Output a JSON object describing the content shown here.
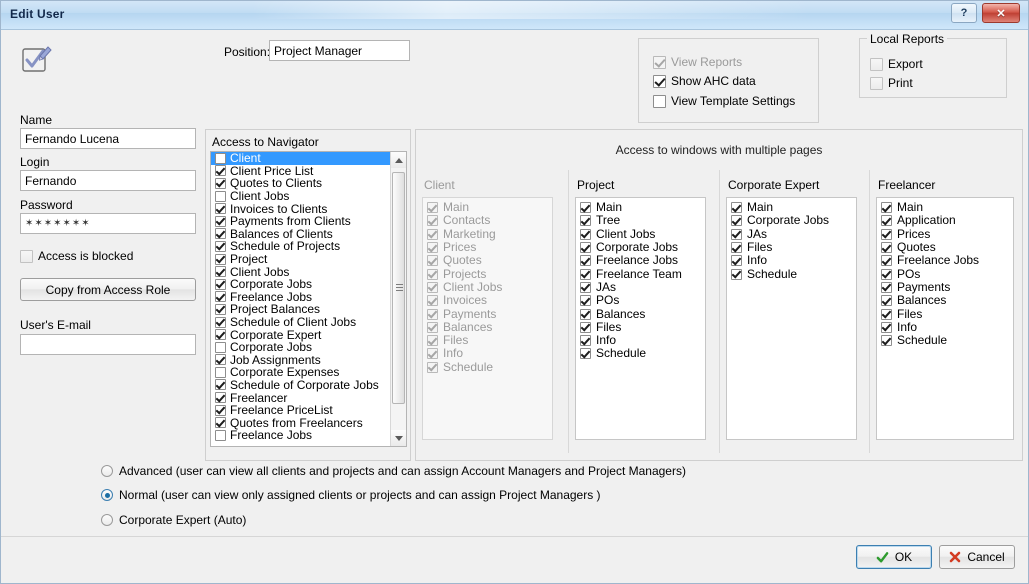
{
  "window": {
    "title": "Edit User",
    "help_button": "?",
    "close_button": "✕",
    "icon": "edit-checkbox-pencil-icon"
  },
  "header": {
    "position_label": "Position:",
    "position_value": "Project Manager",
    "position_placeholder": ""
  },
  "left_form": {
    "name_label": "Name",
    "name_value": "Fernando Lucena",
    "login_label": "Login",
    "login_value": "Fernando",
    "password_label": "Password",
    "password_value": "✶✶✶✶✶✶✶",
    "access_blocked_label": "Access is blocked",
    "access_blocked_checked": false,
    "copy_role_button": "Copy from Access Role",
    "email_label": "User's E-mail",
    "email_value": "",
    "email_placeholder": ""
  },
  "reports_group": {
    "items": [
      {
        "label": "View Reports",
        "checked": true,
        "disabled": true
      },
      {
        "label": "Show AHC data",
        "checked": true,
        "disabled": false
      },
      {
        "label": "View Template Settings",
        "checked": false,
        "disabled": false
      }
    ]
  },
  "local_reports": {
    "legend": "Local Reports",
    "items": [
      {
        "label": "Export",
        "checked": false,
        "disabled": true
      },
      {
        "label": "Print",
        "checked": false,
        "disabled": true
      }
    ]
  },
  "navigator": {
    "title": "Access to Navigator",
    "items": [
      {
        "label": "Client",
        "checked": false,
        "selected": true
      },
      {
        "label": "Client Price List",
        "checked": true,
        "selected": false
      },
      {
        "label": "Quotes to Clients",
        "checked": true,
        "selected": false
      },
      {
        "label": "Client Jobs",
        "checked": false,
        "selected": false
      },
      {
        "label": "Invoices to Clients",
        "checked": true,
        "selected": false
      },
      {
        "label": "Payments from Clients",
        "checked": true,
        "selected": false
      },
      {
        "label": "Balances of Clients",
        "checked": true,
        "selected": false
      },
      {
        "label": "Schedule of Projects",
        "checked": true,
        "selected": false
      },
      {
        "label": "Project",
        "checked": true,
        "selected": false
      },
      {
        "label": "Client Jobs",
        "checked": true,
        "selected": false
      },
      {
        "label": "Corporate Jobs",
        "checked": true,
        "selected": false
      },
      {
        "label": "Freelance Jobs",
        "checked": true,
        "selected": false
      },
      {
        "label": "Project Balances",
        "checked": true,
        "selected": false
      },
      {
        "label": "Schedule of Client Jobs",
        "checked": true,
        "selected": false
      },
      {
        "label": "Corporate Expert",
        "checked": true,
        "selected": false
      },
      {
        "label": "Corporate Jobs",
        "checked": false,
        "selected": false
      },
      {
        "label": "Job Assignments",
        "checked": true,
        "selected": false
      },
      {
        "label": "Corporate Expenses",
        "checked": false,
        "selected": false
      },
      {
        "label": "Schedule of Corporate Jobs",
        "checked": true,
        "selected": false
      },
      {
        "label": "Freelancer",
        "checked": true,
        "selected": false
      },
      {
        "label": "Freelance PriceList",
        "checked": true,
        "selected": false
      },
      {
        "label": "Quotes from Freelancers",
        "checked": true,
        "selected": false
      },
      {
        "label": "Freelance Jobs",
        "checked": false,
        "selected": false
      }
    ]
  },
  "pages_panel": {
    "title": "Access to windows with multiple pages",
    "columns": [
      {
        "title": "Client",
        "disabled": true,
        "items": [
          {
            "label": "Main",
            "checked": true
          },
          {
            "label": "Contacts",
            "checked": true
          },
          {
            "label": "Marketing",
            "checked": true
          },
          {
            "label": "Prices",
            "checked": true
          },
          {
            "label": "Quotes",
            "checked": true
          },
          {
            "label": "Projects",
            "checked": true
          },
          {
            "label": "Client Jobs",
            "checked": true
          },
          {
            "label": "Invoices",
            "checked": true
          },
          {
            "label": "Payments",
            "checked": true
          },
          {
            "label": "Balances",
            "checked": true
          },
          {
            "label": "Files",
            "checked": true
          },
          {
            "label": "Info",
            "checked": true
          },
          {
            "label": "Schedule",
            "checked": true
          }
        ]
      },
      {
        "title": "Project",
        "disabled": false,
        "items": [
          {
            "label": "Main",
            "checked": true
          },
          {
            "label": "Tree",
            "checked": true
          },
          {
            "label": "Client Jobs",
            "checked": true
          },
          {
            "label": "Corporate Jobs",
            "checked": true
          },
          {
            "label": "Freelance Jobs",
            "checked": true
          },
          {
            "label": "Freelance Team",
            "checked": true
          },
          {
            "label": "JAs",
            "checked": true
          },
          {
            "label": "POs",
            "checked": true
          },
          {
            "label": "Balances",
            "checked": true
          },
          {
            "label": "Files",
            "checked": true
          },
          {
            "label": "Info",
            "checked": true
          },
          {
            "label": "Schedule",
            "checked": true
          }
        ]
      },
      {
        "title": "Corporate Expert",
        "disabled": false,
        "items": [
          {
            "label": "Main",
            "checked": true
          },
          {
            "label": "Corporate Jobs",
            "checked": true
          },
          {
            "label": "JAs",
            "checked": true
          },
          {
            "label": "Files",
            "checked": true
          },
          {
            "label": "Info",
            "checked": true
          },
          {
            "label": "Schedule",
            "checked": true
          }
        ]
      },
      {
        "title": "Freelancer",
        "disabled": false,
        "items": [
          {
            "label": "Main",
            "checked": true
          },
          {
            "label": "Application",
            "checked": true
          },
          {
            "label": "Prices",
            "checked": true
          },
          {
            "label": "Quotes",
            "checked": true
          },
          {
            "label": "Freelance Jobs",
            "checked": true
          },
          {
            "label": "POs",
            "checked": true
          },
          {
            "label": "Payments",
            "checked": true
          },
          {
            "label": "Balances",
            "checked": true
          },
          {
            "label": "Files",
            "checked": true
          },
          {
            "label": "Info",
            "checked": true
          },
          {
            "label": "Schedule",
            "checked": true
          }
        ]
      }
    ]
  },
  "role_options": [
    {
      "label": "Advanced (user can view all clients and projects and can assign Account Managers and Project Managers)",
      "selected": false
    },
    {
      "label": "Normal (user can view only assigned clients or projects and can assign Project Managers )",
      "selected": true
    },
    {
      "label": "Corporate Expert (Auto)",
      "selected": false
    }
  ],
  "footer": {
    "ok_label": "OK",
    "cancel_label": "Cancel"
  },
  "colors": {
    "selection": "#3399ff",
    "title_bar": "#c0dcf3",
    "close_button": "#c94636",
    "ok_check": "#2e9b2e",
    "cancel_x": "#d33b22",
    "disabled_text": "#9a9a9a"
  }
}
